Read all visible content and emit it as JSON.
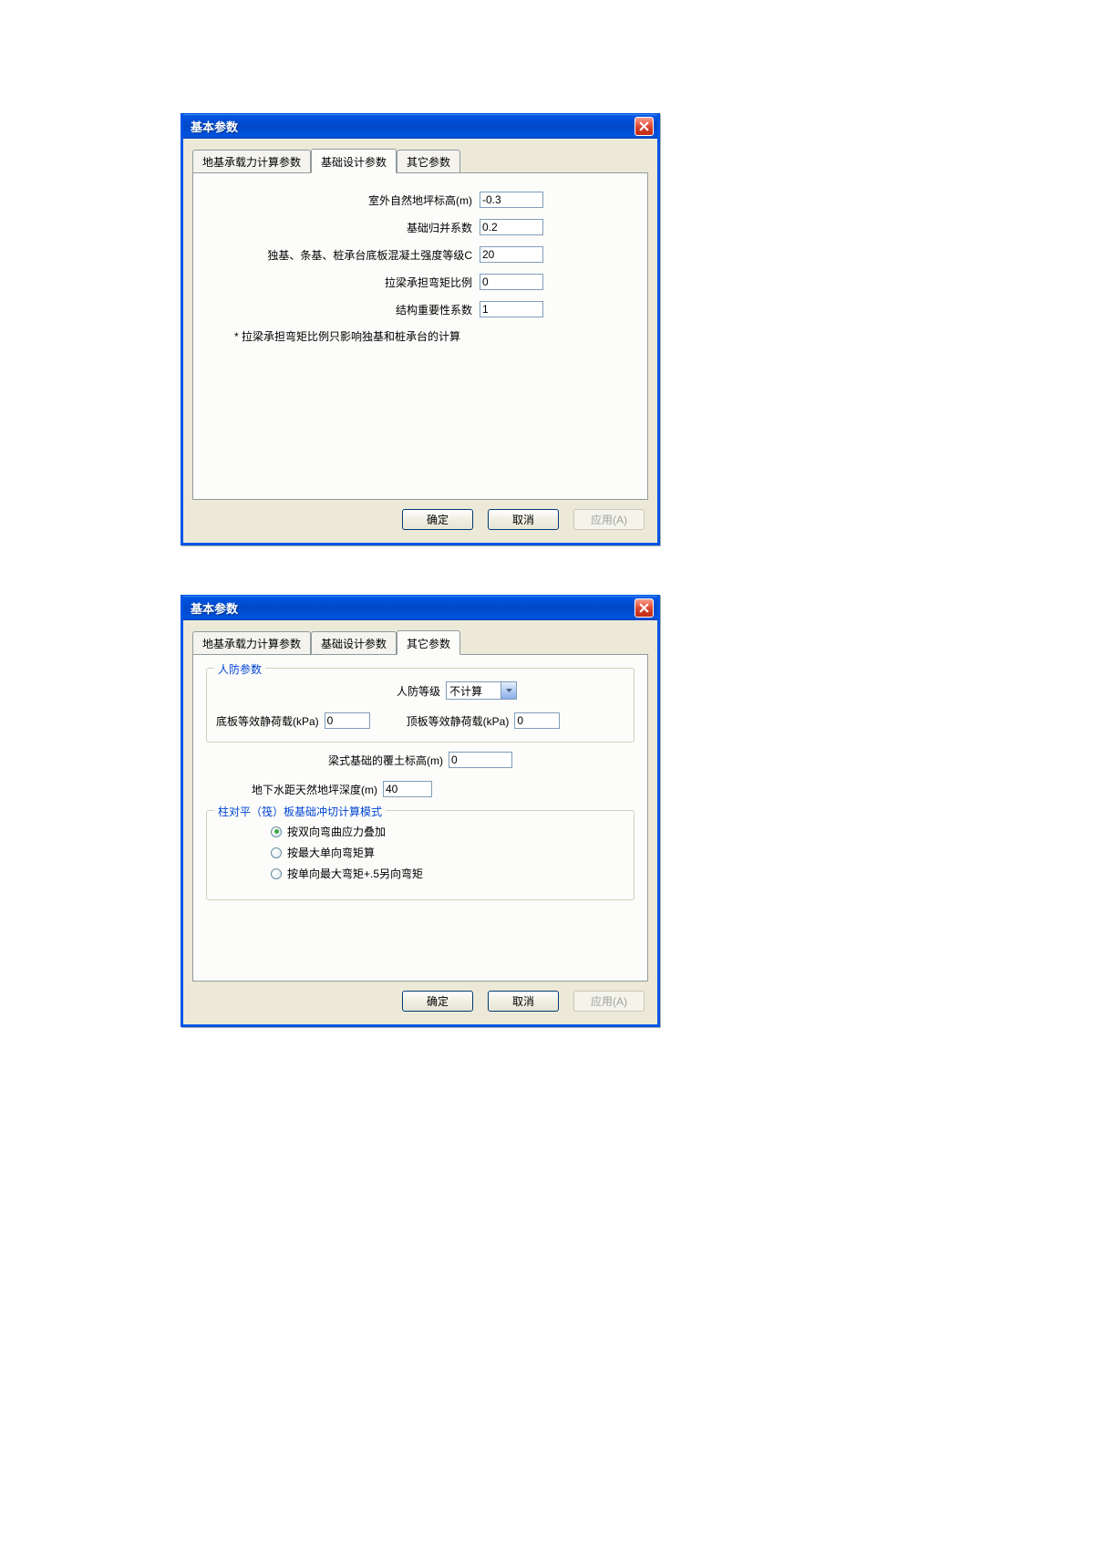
{
  "dialog1": {
    "title": "基本参数",
    "tabs": [
      "地基承载力计算参数",
      "基础设计参数",
      "其它参数"
    ],
    "activeTab": 1,
    "fields": {
      "f1_label": "室外自然地坪标高(m)",
      "f1_value": "-0.3",
      "f2_label": "基础归并系数",
      "f2_value": "0.2",
      "f3_label": "独基、条基、桩承台底板混凝土强度等级C",
      "f3_value": "20",
      "f4_label": "拉梁承担弯矩比例",
      "f4_value": "0",
      "f5_label": "结构重要性系数",
      "f5_value": "1"
    },
    "note": "* 拉梁承担弯矩比例只影响独基和桩承台的计算",
    "buttons": {
      "ok": "确定",
      "cancel": "取消",
      "apply": "应用(A)"
    }
  },
  "dialog2": {
    "title": "基本参数",
    "tabs": [
      "地基承载力计算参数",
      "基础设计参数",
      "其它参数"
    ],
    "activeTab": 2,
    "group1": {
      "title": "人防参数",
      "level_label": "人防等级",
      "level_value": "不计算",
      "bottom_label": "底板等效静荷载(kPa)",
      "bottom_value": "0",
      "top_label": "顶板等效静荷载(kPa)",
      "top_value": "0"
    },
    "row1": {
      "label": "梁式基础的覆土标高(m)",
      "value": "0"
    },
    "row2": {
      "label": "地下水距天然地坪深度(m)",
      "value": "40"
    },
    "group2": {
      "title": "柱对平（筏）板基础冲切计算模式",
      "options": [
        "按双向弯曲应力叠加",
        "按最大单向弯矩算",
        "按单向最大弯矩+.5另向弯矩"
      ],
      "selected": 0
    },
    "buttons": {
      "ok": "确定",
      "cancel": "取消",
      "apply": "应用(A)"
    }
  }
}
